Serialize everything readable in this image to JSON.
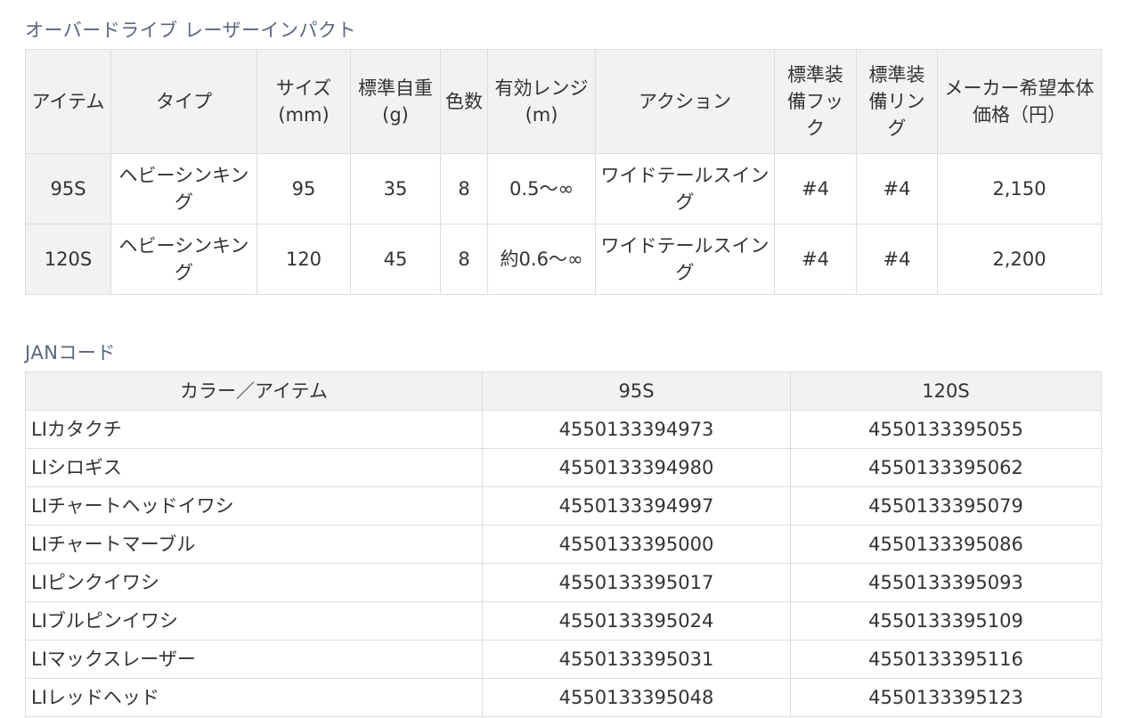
{
  "spec_title": "オーバードライブ レーザーインパクト",
  "spec_headers": [
    "アイテム",
    "タイプ",
    "サイズ(mm)",
    "標準自重(g)",
    "色数",
    "有効レンジ(m)",
    "アクション",
    "標準装備フック",
    "標準装備リング",
    "メーカー希望本体価格（円）"
  ],
  "spec_rows": [
    [
      "95S",
      "ヘビーシンキング",
      "95",
      "35",
      "8",
      "0.5〜∞",
      "ワイドテールスイング",
      "#4",
      "#4",
      "2,150"
    ],
    [
      "120S",
      "ヘビーシンキング",
      "120",
      "45",
      "8",
      "約0.6〜∞",
      "ワイドテールスイング",
      "#4",
      "#4",
      "2,200"
    ]
  ],
  "jan_title": "JANコード",
  "jan_headers": [
    "カラー／アイテム",
    "95S",
    "120S"
  ],
  "jan_rows": [
    [
      "LIカタクチ",
      "4550133394973",
      "4550133395055"
    ],
    [
      "LIシロギス",
      "4550133394980",
      "4550133395062"
    ],
    [
      "LIチャートヘッドイワシ",
      "4550133394997",
      "4550133395079"
    ],
    [
      "LIチャートマーブル",
      "4550133395000",
      "4550133395086"
    ],
    [
      "LIピンクイワシ",
      "4550133395017",
      "4550133395093"
    ],
    [
      "LIブルピンイワシ",
      "4550133395024",
      "4550133395109"
    ],
    [
      "LIマックスレーザー",
      "4550133395031",
      "4550133395116"
    ],
    [
      "LIレッドヘッド",
      "4550133395048",
      "4550133395123"
    ]
  ]
}
